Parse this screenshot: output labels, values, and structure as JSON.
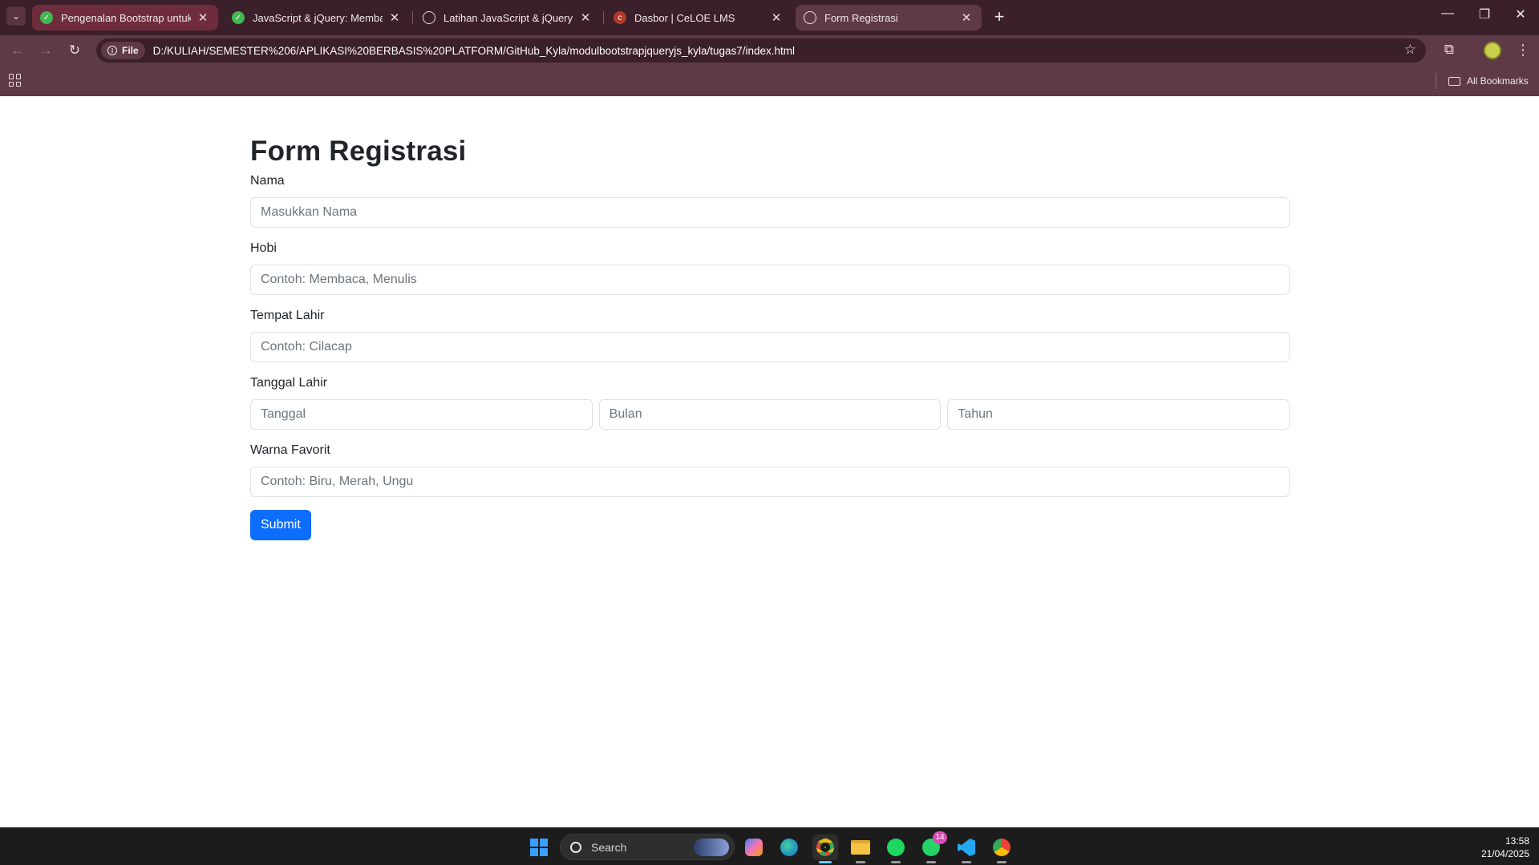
{
  "browser": {
    "tabs": [
      {
        "title": "Pengenalan Bootstrap untuk Web",
        "close": "✕"
      },
      {
        "title": "JavaScript & jQuery: Membangun",
        "close": "✕"
      },
      {
        "title": "Latihan JavaScript & jQuery",
        "close": "✕"
      },
      {
        "title": "Dasbor | CeLOE LMS",
        "close": "✕"
      },
      {
        "title": "Form Registrasi",
        "close": "✕"
      }
    ],
    "new_tab": "+",
    "window_controls": {
      "minimize": "—",
      "maximize": "❐",
      "close": "✕"
    },
    "address": {
      "chip": "File",
      "url": "D:/KULIAH/SEMESTER%206/APLIKASI%20BERBASIS%20PLATFORM/GitHub_Kyla/modulbootstrapjqueryjs_kyla/tugas7/index.html"
    },
    "bookmarks_label": "All Bookmarks",
    "icons": {
      "back": "←",
      "forward": "→",
      "reload": "↻",
      "star": "☆",
      "extensions": "⧉",
      "menu": "⋮"
    }
  },
  "form": {
    "title": "Form Registrasi",
    "nama": {
      "label": "Nama",
      "placeholder": "Masukkan Nama"
    },
    "hobi": {
      "label": "Hobi",
      "placeholder": "Contoh: Membaca, Menulis"
    },
    "tempat_lahir": {
      "label": "Tempat Lahir",
      "placeholder": "Contoh: Cilacap"
    },
    "tanggal_lahir": {
      "label": "Tanggal Lahir",
      "tanggal_placeholder": "Tanggal",
      "bulan_placeholder": "Bulan",
      "tahun_placeholder": "Tahun"
    },
    "warna_favorit": {
      "label": "Warna Favorit",
      "placeholder": "Contoh: Biru, Merah, Ungu"
    },
    "submit_label": "Submit"
  },
  "taskbar": {
    "search_label": "Search",
    "whatsapp_badge": "14",
    "time": "13:58",
    "date": "21/04/2025"
  },
  "colors": {
    "accent": "#0d6efd",
    "chrome_dark": "#3b1f2a",
    "chrome_mid": "#5e3946"
  }
}
